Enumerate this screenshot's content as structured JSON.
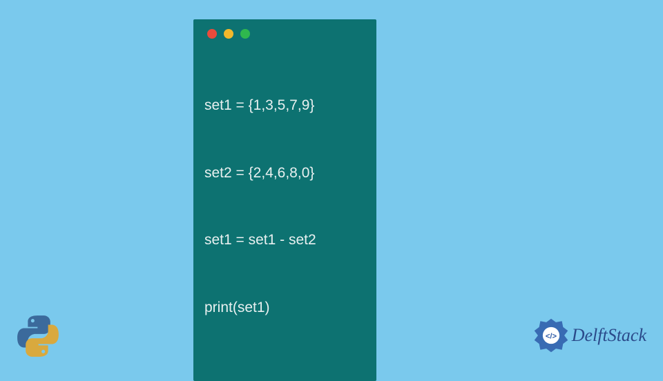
{
  "code": {
    "lines": [
      "set1 = {1,3,5,7,9}",
      "set2 = {2,4,6,8,0}",
      "set1 = set1 - set2",
      "print(set1)"
    ]
  },
  "window_controls": {
    "red": "#e94b3c",
    "yellow": "#f1b82c",
    "green": "#2fb84e"
  },
  "brand": {
    "name": "DelftStack"
  },
  "colors": {
    "background": "#7ac9ed",
    "window": "#0d7271",
    "code_text": "#e8f0f0",
    "brand_text": "#2a4a8a"
  }
}
